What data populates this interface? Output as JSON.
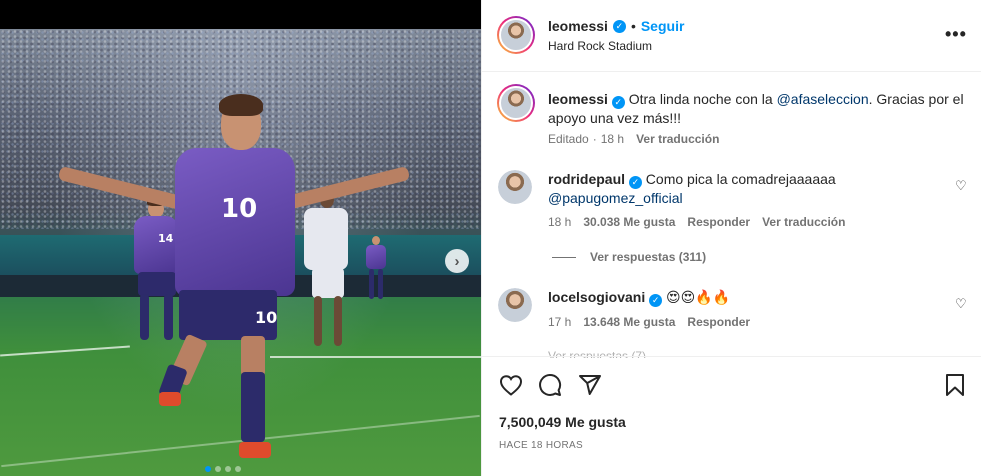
{
  "post": {
    "author": "leomessi",
    "follow_label": "Seguir",
    "separator": "•",
    "location": "Hard Rock Stadium",
    "more_label": "•••",
    "jersey_number": "10",
    "teammate_number": "14",
    "next_label": "›"
  },
  "caption": {
    "username": "leomessi",
    "text_before": "Otra linda noche con la ",
    "mention": "@afaseleccion",
    "text_after": ". Gracias por el apoyo una vez más!!!",
    "edited": "Editado",
    "time": "18 h",
    "translate": "Ver traducción"
  },
  "comments": [
    {
      "username": "rodridepaul",
      "text": "Como pica la comadrejaaaaaa",
      "mention": "@papugomez_official",
      "time": "18 h",
      "likes": "30.038 Me gusta",
      "reply": "Responder",
      "translate": "Ver traducción",
      "view_replies": "Ver respuestas (311)"
    },
    {
      "username": "locelsogiovani",
      "text": "😍😍🔥🔥",
      "time": "17 h",
      "likes": "13.648 Me gusta",
      "reply": "Responder"
    }
  ],
  "faded_text": "Ver respuestas (7)",
  "footer": {
    "likes": "7,500,049 Me gusta",
    "ago": "HACE 18 HORAS"
  },
  "colors": {
    "accent": "#0095f6",
    "mention": "#00376b",
    "muted": "#737373",
    "jersey": "#6a4fb6"
  },
  "icons": [
    "verified-badge-icon",
    "more-icon",
    "heart-icon",
    "comment-icon",
    "share-icon",
    "bookmark-icon",
    "next-arrow-icon"
  ]
}
